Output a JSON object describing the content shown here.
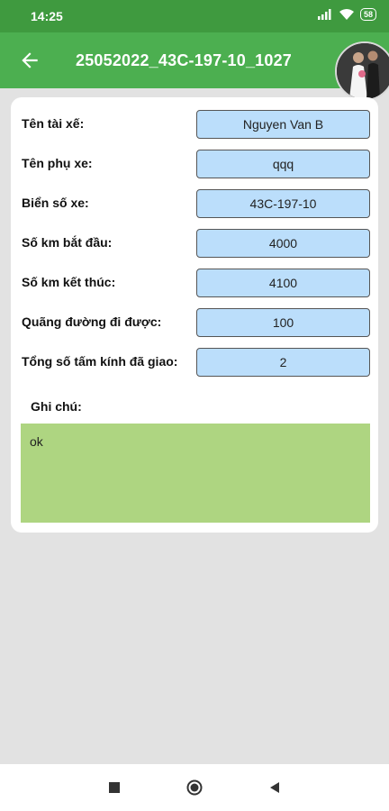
{
  "status_bar": {
    "time": "14:25",
    "battery": "58"
  },
  "app_bar": {
    "title": "25052022_43C-197-10_1027"
  },
  "fields": [
    {
      "label": "Tên tài xế:",
      "value": "Nguyen Van B"
    },
    {
      "label": "Tên phụ xe:",
      "value": "qqq"
    },
    {
      "label": "Biển số xe:",
      "value": "43C-197-10"
    },
    {
      "label": "Số km bắt đầu:",
      "value": "4000"
    },
    {
      "label": "Số km kết thúc:",
      "value": "4100"
    },
    {
      "label": "Quãng đường đi được:",
      "value": "100"
    },
    {
      "label": "Tổng số tấm kính đã giao:",
      "value": "2"
    }
  ],
  "note": {
    "label": "Ghi chú:",
    "value": "ok"
  },
  "colors": {
    "appbar": "#4caf50",
    "statusbar": "#3f9a3f",
    "field_bg": "#bbdefb",
    "note_bg": "#aed581"
  },
  "icons": [
    "back-arrow-icon",
    "signal-icon",
    "wifi-icon",
    "battery-icon",
    "recent-apps-icon",
    "home-icon",
    "nav-back-icon"
  ]
}
